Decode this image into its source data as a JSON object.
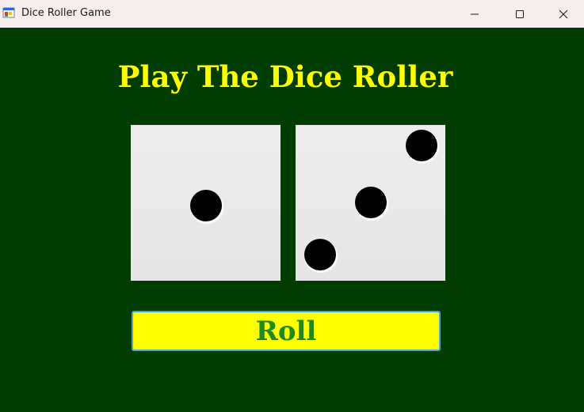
{
  "window": {
    "title": "Dice Roller Game",
    "icon": "windows-forms-app-icon",
    "controls": {
      "minimize_icon": "minimize-icon",
      "maximize_icon": "maximize-icon",
      "close_icon": "close-icon"
    }
  },
  "game": {
    "heading": "Play The Dice Roller",
    "dice": [
      {
        "value": 1
      },
      {
        "value": 3
      }
    ],
    "roll_button_label": "Roll"
  },
  "colors": {
    "background": "#013d00",
    "heading": "#ffff00",
    "button_background": "#ffff00",
    "button_text": "#1e8a1e",
    "die_face": "#e9e9e9",
    "pip": "#000000"
  }
}
